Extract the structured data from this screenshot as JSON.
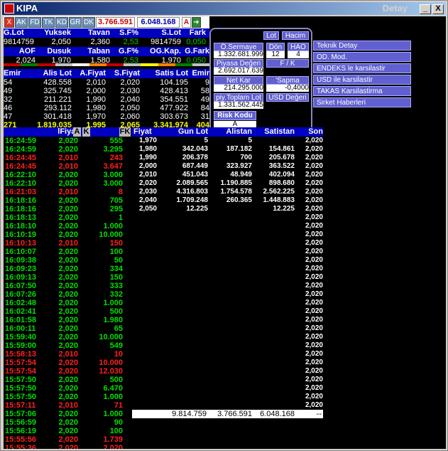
{
  "window": {
    "title": "KIPA",
    "right_title": "Detay",
    "btn_min": "_",
    "btn_max": "□",
    "btn_close": "X"
  },
  "toolbar": {
    "items": [
      "X",
      "AK",
      "FD",
      "TK",
      "KD",
      "GR",
      "DK"
    ],
    "price1": "3.766.591",
    "price2": "6.048.168",
    "btn_a": "A"
  },
  "summary": {
    "h1": [
      "G.Lot",
      "Yuksek",
      "Tavan",
      "S.F%",
      "S.Lot",
      "Fark"
    ],
    "v1": [
      "9814759",
      "2,050",
      "2,360",
      "2,53",
      "9814759",
      "0,050"
    ],
    "h2": [
      "AOF",
      "Dusuk",
      "Taban",
      "G.F%",
      "OG.Kap.",
      "G.Fark"
    ],
    "v2": [
      "2,024",
      "1,970",
      "1,580",
      "2,53",
      "1,970",
      "0,050"
    ],
    "bar_colors": [
      "#c00000",
      "#008000",
      "#c00000",
      "#c0c0c0",
      "#ffffff",
      "#ff8000",
      "#c00000",
      "#c0c0c0",
      "#ffff00",
      "#ff8000",
      "#008000",
      "#c0c0c0"
    ]
  },
  "orders": {
    "headers": [
      "Emir",
      "Alis Lot",
      "A.Fiyat",
      "S.Fiyat",
      "Satis Lot",
      "Emir"
    ],
    "rows": [
      [
        "54",
        "428.558",
        "2,010",
        "2,020",
        "104.195",
        "9"
      ],
      [
        "49",
        "325.745",
        "2,000",
        "2,030",
        "428.413",
        "58"
      ],
      [
        "32",
        "211.221",
        "1,990",
        "2,040",
        "354.551",
        "49"
      ],
      [
        "46",
        "293.112",
        "1,980",
        "2,050",
        "477.922",
        "84"
      ],
      [
        "47",
        "301.418",
        "1,970",
        "2,060",
        "303.673",
        "31"
      ]
    ],
    "total": [
      "271",
      "1.819.035",
      "1,995",
      "2,065",
      "3.341.974",
      "404"
    ]
  },
  "panel": {
    "lot": "Lot",
    "hacim": "Hacim",
    "osermaye_label": "Ö.Sermaye",
    "osermaye": "1.332.681.999",
    "don_label": "Dön",
    "don": "12",
    "hao_label": "HAO",
    "hao": "4",
    "piyasa_label": "Piyasa Değeri",
    "piyasa": "2.692.017.639",
    "fk_label": "F / K",
    "netkar_label": "Net Kar",
    "netkar": "214.295.000",
    "sapma_label": "'Sapma",
    "sapma": "-0,4000",
    "piy_label": "piy.Toplam Lot",
    "piy": "1.331.562.445",
    "usd_label": "USD Değeri",
    "risk_label": "Risk Kodu",
    "risk": "A"
  },
  "menu": [
    "Teknik Detay",
    "OD. Mod.",
    "ENDEKS le karsilastir",
    "USD ile karsilastir",
    "TAKAS Karsilastirma",
    "Sirket Haberleri"
  ],
  "trades": {
    "headers": [
      "",
      "lFiyat",
      "A",
      "K",
      "FK"
    ],
    "colors": {
      "up": "#00e000",
      "down": "#ff2020",
      "price_up": "#00e000",
      "price_down": "#ff2020"
    },
    "rows": [
      [
        "16:24:59",
        "2,020",
        "555",
        "g"
      ],
      [
        "16:24:59",
        "2,020",
        "3.295",
        "g"
      ],
      [
        "16:24:45",
        "2,010",
        "243",
        "r"
      ],
      [
        "16:24:45",
        "2,010",
        "3.647",
        "r"
      ],
      [
        "16:22:10",
        "2,020",
        "3.000",
        "g"
      ],
      [
        "16:22:10",
        "2,020",
        "3.000",
        "g"
      ],
      [
        "16:21:03",
        "2,010",
        "8",
        "r"
      ],
      [
        "16:18:16",
        "2,020",
        "705",
        "g"
      ],
      [
        "16:18:16",
        "2,020",
        "295",
        "g"
      ],
      [
        "16:18:13",
        "2,020",
        "1",
        "g"
      ],
      [
        "16:18:10",
        "2,020",
        "1.000",
        "g"
      ],
      [
        "16:10:19",
        "2,020",
        "10.000",
        "g"
      ],
      [
        "16:10:13",
        "2,010",
        "150",
        "r"
      ],
      [
        "16:10:07",
        "2,020",
        "100",
        "g"
      ],
      [
        "16:09:38",
        "2,020",
        "50",
        "g"
      ],
      [
        "16:09:23",
        "2,020",
        "334",
        "g"
      ],
      [
        "16:09:13",
        "2,020",
        "150",
        "g"
      ],
      [
        "16:07:50",
        "2,020",
        "333",
        "g"
      ],
      [
        "16:07:26",
        "2,020",
        "332",
        "g"
      ],
      [
        "16:02:48",
        "2,020",
        "1.000",
        "g"
      ],
      [
        "16:02:41",
        "2,020",
        "500",
        "g"
      ],
      [
        "16:01:58",
        "2,020",
        "1.980",
        "g"
      ],
      [
        "16:00:11",
        "2,020",
        "65",
        "g"
      ],
      [
        "15:59:40",
        "2,020",
        "10.000",
        "g"
      ],
      [
        "15:59:00",
        "2,020",
        "549",
        "g"
      ],
      [
        "15:58:13",
        "2,010",
        "10",
        "r"
      ],
      [
        "15:57:54",
        "2,020",
        "10.000",
        "r"
      ],
      [
        "15:57:54",
        "2,020",
        "12.030",
        "r"
      ],
      [
        "15:57:50",
        "2,020",
        "500",
        "g"
      ],
      [
        "15:57:50",
        "2,020",
        "6.470",
        "g"
      ],
      [
        "15:57:50",
        "2,020",
        "1.000",
        "g"
      ],
      [
        "15:57:11",
        "2,010",
        "71",
        "r"
      ],
      [
        "15:57:06",
        "2,020",
        "1.000",
        "g"
      ],
      [
        "15:56:59",
        "2,020",
        "90",
        "g"
      ],
      [
        "15:56:19",
        "2,020",
        "100",
        "g"
      ],
      [
        "15:55:56",
        "2,020",
        "1.739",
        "r"
      ],
      [
        "15:55:36",
        "2,020",
        "2,020",
        "r"
      ]
    ]
  },
  "depth": {
    "headers": [
      "Fiyat",
      "Gun Lot",
      "Alistan",
      "Satistan",
      "Son"
    ],
    "rows": [
      [
        "1,970",
        "5",
        "5",
        "",
        "2,020"
      ],
      [
        "1,980",
        "342.043",
        "187.182",
        "154.861",
        "2,020"
      ],
      [
        "1,990",
        "206.378",
        "700",
        "205.678",
        "2,020"
      ],
      [
        "2,000",
        "687.449",
        "323.927",
        "363.522",
        "2,020"
      ],
      [
        "2,010",
        "451.043",
        "48.949",
        "402.094",
        "2,020"
      ],
      [
        "2,020",
        "2.089.565",
        "1.190.885",
        "898.680",
        "2,020"
      ],
      [
        "2,030",
        "4.316.803",
        "1.754.578",
        "2.562.225",
        "2,020"
      ],
      [
        "2,040",
        "1.709.248",
        "260.365",
        "1.448.883",
        "2,020"
      ],
      [
        "2,050",
        "12.225",
        "",
        "12.225",
        "2,020"
      ]
    ],
    "son_fill": "2,020",
    "totals": [
      "9.814.759",
      "3.766.591",
      "6.048.168",
      "--"
    ]
  }
}
